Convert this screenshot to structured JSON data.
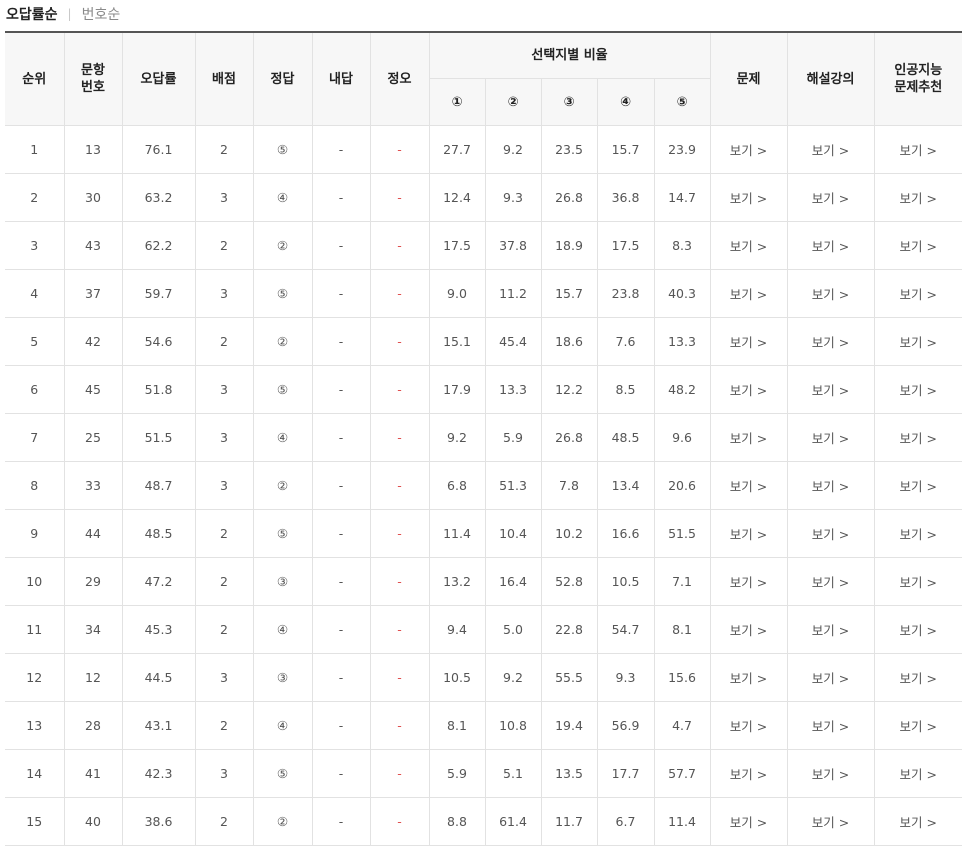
{
  "sort_tabs": {
    "active": "오답률순",
    "separator": "|",
    "inactive": "번호순"
  },
  "columns": {
    "rank": "순위",
    "question_no": "문항\n번호",
    "error_rate": "오답률",
    "points": "배점",
    "answer": "정답",
    "my_answer": "내답",
    "correct_wrong": "정오",
    "choice_ratio": "선택지별 비율",
    "choices": [
      "①",
      "②",
      "③",
      "④",
      "⑤"
    ],
    "question": "문제",
    "lecture": "해설강의",
    "ai_recommend": "인공지능\n문제추천"
  },
  "link_label": "보기 >",
  "rows": [
    {
      "rank": "1",
      "no": "13",
      "rate": "76.1",
      "pts": "2",
      "ans": "⑤",
      "mine": "-",
      "ox": "-",
      "c": [
        "27.7",
        "9.2",
        "23.5",
        "15.7",
        "23.9"
      ]
    },
    {
      "rank": "2",
      "no": "30",
      "rate": "63.2",
      "pts": "3",
      "ans": "④",
      "mine": "-",
      "ox": "-",
      "c": [
        "12.4",
        "9.3",
        "26.8",
        "36.8",
        "14.7"
      ]
    },
    {
      "rank": "3",
      "no": "43",
      "rate": "62.2",
      "pts": "2",
      "ans": "②",
      "mine": "-",
      "ox": "-",
      "c": [
        "17.5",
        "37.8",
        "18.9",
        "17.5",
        "8.3"
      ]
    },
    {
      "rank": "4",
      "no": "37",
      "rate": "59.7",
      "pts": "3",
      "ans": "⑤",
      "mine": "-",
      "ox": "-",
      "c": [
        "9.0",
        "11.2",
        "15.7",
        "23.8",
        "40.3"
      ]
    },
    {
      "rank": "5",
      "no": "42",
      "rate": "54.6",
      "pts": "2",
      "ans": "②",
      "mine": "-",
      "ox": "-",
      "c": [
        "15.1",
        "45.4",
        "18.6",
        "7.6",
        "13.3"
      ]
    },
    {
      "rank": "6",
      "no": "45",
      "rate": "51.8",
      "pts": "3",
      "ans": "⑤",
      "mine": "-",
      "ox": "-",
      "c": [
        "17.9",
        "13.3",
        "12.2",
        "8.5",
        "48.2"
      ]
    },
    {
      "rank": "7",
      "no": "25",
      "rate": "51.5",
      "pts": "3",
      "ans": "④",
      "mine": "-",
      "ox": "-",
      "c": [
        "9.2",
        "5.9",
        "26.8",
        "48.5",
        "9.6"
      ]
    },
    {
      "rank": "8",
      "no": "33",
      "rate": "48.7",
      "pts": "3",
      "ans": "②",
      "mine": "-",
      "ox": "-",
      "c": [
        "6.8",
        "51.3",
        "7.8",
        "13.4",
        "20.6"
      ]
    },
    {
      "rank": "9",
      "no": "44",
      "rate": "48.5",
      "pts": "2",
      "ans": "⑤",
      "mine": "-",
      "ox": "-",
      "c": [
        "11.4",
        "10.4",
        "10.2",
        "16.6",
        "51.5"
      ]
    },
    {
      "rank": "10",
      "no": "29",
      "rate": "47.2",
      "pts": "2",
      "ans": "③",
      "mine": "-",
      "ox": "-",
      "c": [
        "13.2",
        "16.4",
        "52.8",
        "10.5",
        "7.1"
      ]
    },
    {
      "rank": "11",
      "no": "34",
      "rate": "45.3",
      "pts": "2",
      "ans": "④",
      "mine": "-",
      "ox": "-",
      "c": [
        "9.4",
        "5.0",
        "22.8",
        "54.7",
        "8.1"
      ]
    },
    {
      "rank": "12",
      "no": "12",
      "rate": "44.5",
      "pts": "3",
      "ans": "③",
      "mine": "-",
      "ox": "-",
      "c": [
        "10.5",
        "9.2",
        "55.5",
        "9.3",
        "15.6"
      ]
    },
    {
      "rank": "13",
      "no": "28",
      "rate": "43.1",
      "pts": "2",
      "ans": "④",
      "mine": "-",
      "ox": "-",
      "c": [
        "8.1",
        "10.8",
        "19.4",
        "56.9",
        "4.7"
      ]
    },
    {
      "rank": "14",
      "no": "41",
      "rate": "42.3",
      "pts": "3",
      "ans": "⑤",
      "mine": "-",
      "ox": "-",
      "c": [
        "5.9",
        "5.1",
        "13.5",
        "17.7",
        "57.7"
      ]
    },
    {
      "rank": "15",
      "no": "40",
      "rate": "38.6",
      "pts": "2",
      "ans": "②",
      "mine": "-",
      "ox": "-",
      "c": [
        "8.8",
        "61.4",
        "11.7",
        "6.7",
        "11.4"
      ]
    }
  ]
}
